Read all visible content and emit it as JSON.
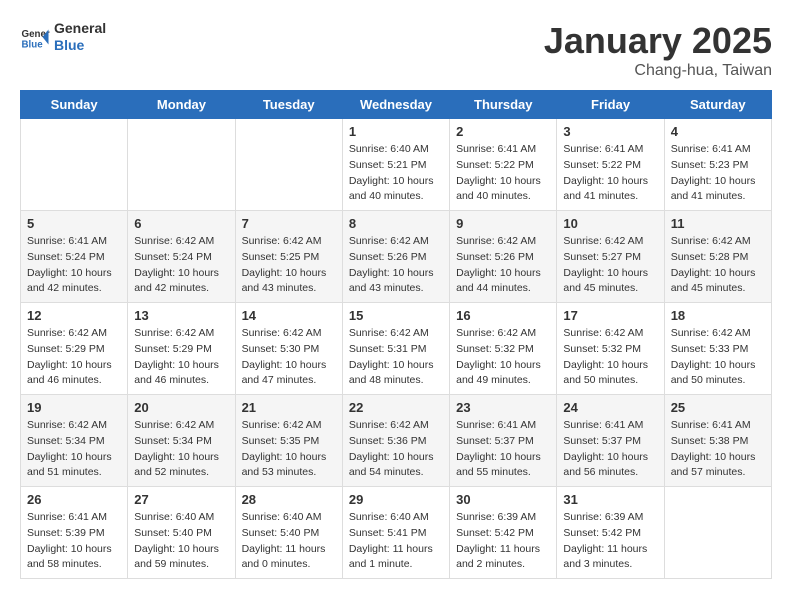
{
  "header": {
    "logo_general": "General",
    "logo_blue": "Blue",
    "month_year": "January 2025",
    "location": "Chang-hua, Taiwan"
  },
  "weekdays": [
    "Sunday",
    "Monday",
    "Tuesday",
    "Wednesday",
    "Thursday",
    "Friday",
    "Saturday"
  ],
  "weeks": [
    [
      {
        "day": "",
        "sunrise": "",
        "sunset": "",
        "daylight": ""
      },
      {
        "day": "",
        "sunrise": "",
        "sunset": "",
        "daylight": ""
      },
      {
        "day": "",
        "sunrise": "",
        "sunset": "",
        "daylight": ""
      },
      {
        "day": "1",
        "sunrise": "Sunrise: 6:40 AM",
        "sunset": "Sunset: 5:21 PM",
        "daylight": "Daylight: 10 hours and 40 minutes."
      },
      {
        "day": "2",
        "sunrise": "Sunrise: 6:41 AM",
        "sunset": "Sunset: 5:22 PM",
        "daylight": "Daylight: 10 hours and 40 minutes."
      },
      {
        "day": "3",
        "sunrise": "Sunrise: 6:41 AM",
        "sunset": "Sunset: 5:22 PM",
        "daylight": "Daylight: 10 hours and 41 minutes."
      },
      {
        "day": "4",
        "sunrise": "Sunrise: 6:41 AM",
        "sunset": "Sunset: 5:23 PM",
        "daylight": "Daylight: 10 hours and 41 minutes."
      }
    ],
    [
      {
        "day": "5",
        "sunrise": "Sunrise: 6:41 AM",
        "sunset": "Sunset: 5:24 PM",
        "daylight": "Daylight: 10 hours and 42 minutes."
      },
      {
        "day": "6",
        "sunrise": "Sunrise: 6:42 AM",
        "sunset": "Sunset: 5:24 PM",
        "daylight": "Daylight: 10 hours and 42 minutes."
      },
      {
        "day": "7",
        "sunrise": "Sunrise: 6:42 AM",
        "sunset": "Sunset: 5:25 PM",
        "daylight": "Daylight: 10 hours and 43 minutes."
      },
      {
        "day": "8",
        "sunrise": "Sunrise: 6:42 AM",
        "sunset": "Sunset: 5:26 PM",
        "daylight": "Daylight: 10 hours and 43 minutes."
      },
      {
        "day": "9",
        "sunrise": "Sunrise: 6:42 AM",
        "sunset": "Sunset: 5:26 PM",
        "daylight": "Daylight: 10 hours and 44 minutes."
      },
      {
        "day": "10",
        "sunrise": "Sunrise: 6:42 AM",
        "sunset": "Sunset: 5:27 PM",
        "daylight": "Daylight: 10 hours and 45 minutes."
      },
      {
        "day": "11",
        "sunrise": "Sunrise: 6:42 AM",
        "sunset": "Sunset: 5:28 PM",
        "daylight": "Daylight: 10 hours and 45 minutes."
      }
    ],
    [
      {
        "day": "12",
        "sunrise": "Sunrise: 6:42 AM",
        "sunset": "Sunset: 5:29 PM",
        "daylight": "Daylight: 10 hours and 46 minutes."
      },
      {
        "day": "13",
        "sunrise": "Sunrise: 6:42 AM",
        "sunset": "Sunset: 5:29 PM",
        "daylight": "Daylight: 10 hours and 46 minutes."
      },
      {
        "day": "14",
        "sunrise": "Sunrise: 6:42 AM",
        "sunset": "Sunset: 5:30 PM",
        "daylight": "Daylight: 10 hours and 47 minutes."
      },
      {
        "day": "15",
        "sunrise": "Sunrise: 6:42 AM",
        "sunset": "Sunset: 5:31 PM",
        "daylight": "Daylight: 10 hours and 48 minutes."
      },
      {
        "day": "16",
        "sunrise": "Sunrise: 6:42 AM",
        "sunset": "Sunset: 5:32 PM",
        "daylight": "Daylight: 10 hours and 49 minutes."
      },
      {
        "day": "17",
        "sunrise": "Sunrise: 6:42 AM",
        "sunset": "Sunset: 5:32 PM",
        "daylight": "Daylight: 10 hours and 50 minutes."
      },
      {
        "day": "18",
        "sunrise": "Sunrise: 6:42 AM",
        "sunset": "Sunset: 5:33 PM",
        "daylight": "Daylight: 10 hours and 50 minutes."
      }
    ],
    [
      {
        "day": "19",
        "sunrise": "Sunrise: 6:42 AM",
        "sunset": "Sunset: 5:34 PM",
        "daylight": "Daylight: 10 hours and 51 minutes."
      },
      {
        "day": "20",
        "sunrise": "Sunrise: 6:42 AM",
        "sunset": "Sunset: 5:34 PM",
        "daylight": "Daylight: 10 hours and 52 minutes."
      },
      {
        "day": "21",
        "sunrise": "Sunrise: 6:42 AM",
        "sunset": "Sunset: 5:35 PM",
        "daylight": "Daylight: 10 hours and 53 minutes."
      },
      {
        "day": "22",
        "sunrise": "Sunrise: 6:42 AM",
        "sunset": "Sunset: 5:36 PM",
        "daylight": "Daylight: 10 hours and 54 minutes."
      },
      {
        "day": "23",
        "sunrise": "Sunrise: 6:41 AM",
        "sunset": "Sunset: 5:37 PM",
        "daylight": "Daylight: 10 hours and 55 minutes."
      },
      {
        "day": "24",
        "sunrise": "Sunrise: 6:41 AM",
        "sunset": "Sunset: 5:37 PM",
        "daylight": "Daylight: 10 hours and 56 minutes."
      },
      {
        "day": "25",
        "sunrise": "Sunrise: 6:41 AM",
        "sunset": "Sunset: 5:38 PM",
        "daylight": "Daylight: 10 hours and 57 minutes."
      }
    ],
    [
      {
        "day": "26",
        "sunrise": "Sunrise: 6:41 AM",
        "sunset": "Sunset: 5:39 PM",
        "daylight": "Daylight: 10 hours and 58 minutes."
      },
      {
        "day": "27",
        "sunrise": "Sunrise: 6:40 AM",
        "sunset": "Sunset: 5:40 PM",
        "daylight": "Daylight: 10 hours and 59 minutes."
      },
      {
        "day": "28",
        "sunrise": "Sunrise: 6:40 AM",
        "sunset": "Sunset: 5:40 PM",
        "daylight": "Daylight: 11 hours and 0 minutes."
      },
      {
        "day": "29",
        "sunrise": "Sunrise: 6:40 AM",
        "sunset": "Sunset: 5:41 PM",
        "daylight": "Daylight: 11 hours and 1 minute."
      },
      {
        "day": "30",
        "sunrise": "Sunrise: 6:39 AM",
        "sunset": "Sunset: 5:42 PM",
        "daylight": "Daylight: 11 hours and 2 minutes."
      },
      {
        "day": "31",
        "sunrise": "Sunrise: 6:39 AM",
        "sunset": "Sunset: 5:42 PM",
        "daylight": "Daylight: 11 hours and 3 minutes."
      },
      {
        "day": "",
        "sunrise": "",
        "sunset": "",
        "daylight": ""
      }
    ]
  ]
}
